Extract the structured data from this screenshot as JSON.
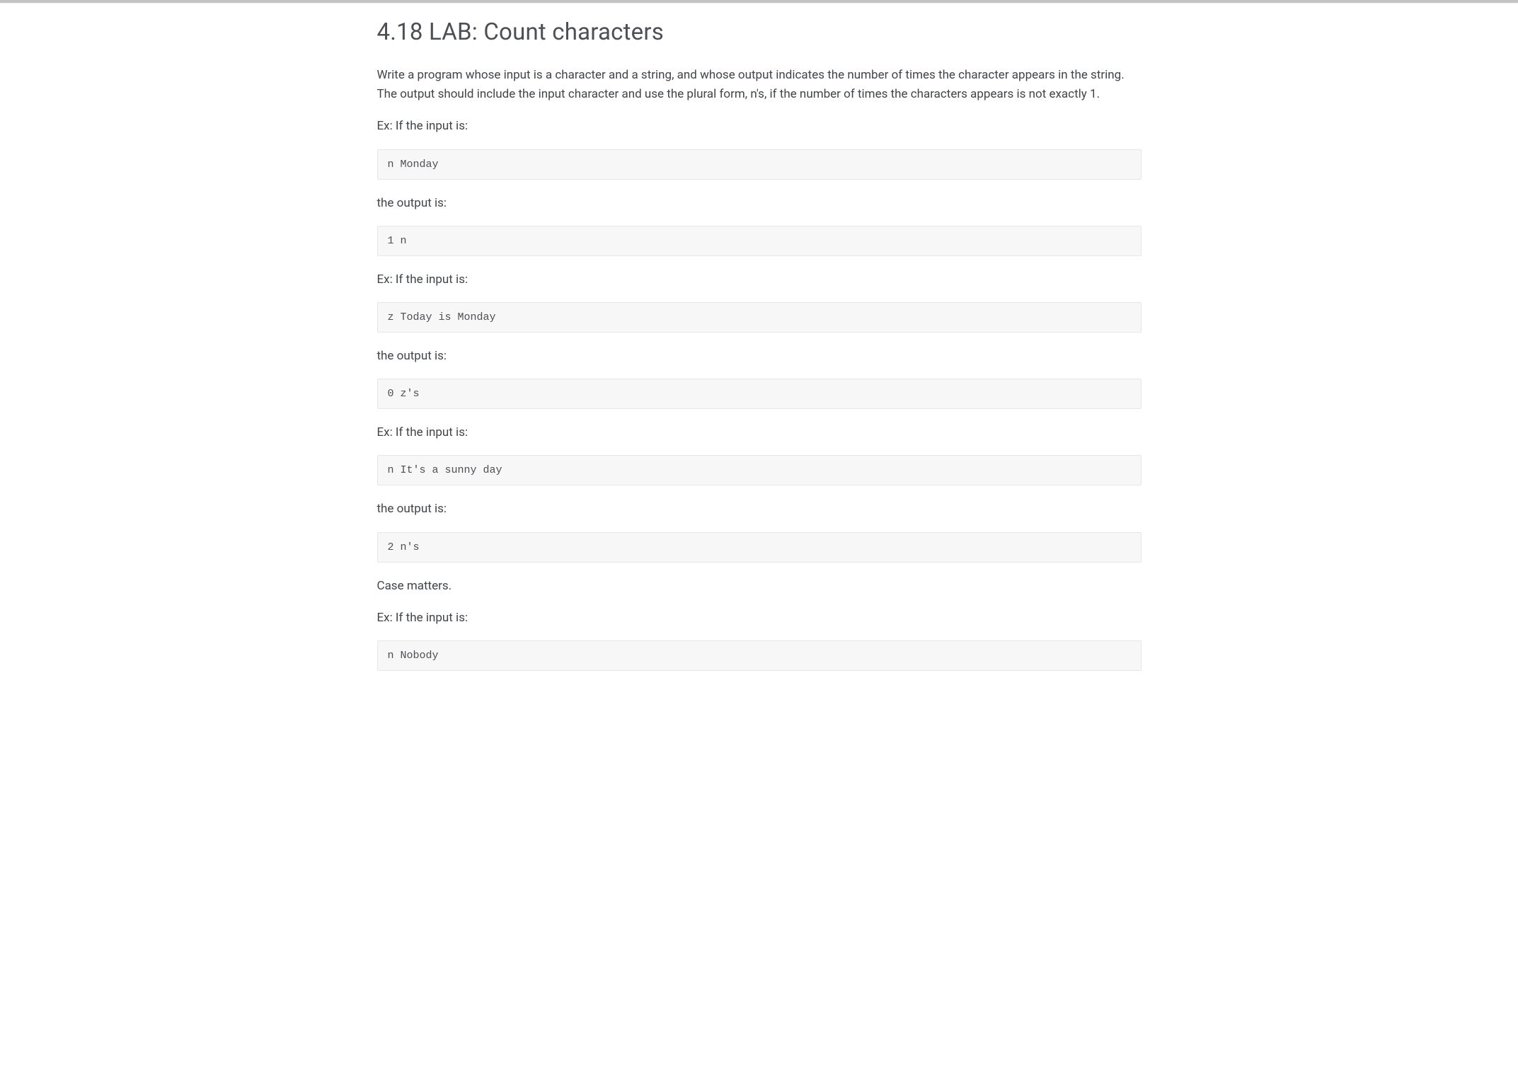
{
  "heading": "4.18 LAB: Count characters",
  "intro": "Write a program whose input is a character and a string, and whose output indicates the number of times the character appears in the string. The output should include the input character and use the plural form, n's, if the number of times the characters appears is not exactly 1.",
  "labels": {
    "exInput": "Ex: If the input is:",
    "outputIs": "the output is:",
    "caseMatters": "Case matters."
  },
  "examples": [
    {
      "input": "n Monday",
      "output": "1 n"
    },
    {
      "input": "z Today is Monday",
      "output": "0 z's"
    },
    {
      "input": "n It's a sunny day",
      "output": "2 n's"
    }
  ],
  "trailing": {
    "input": "n Nobody"
  }
}
